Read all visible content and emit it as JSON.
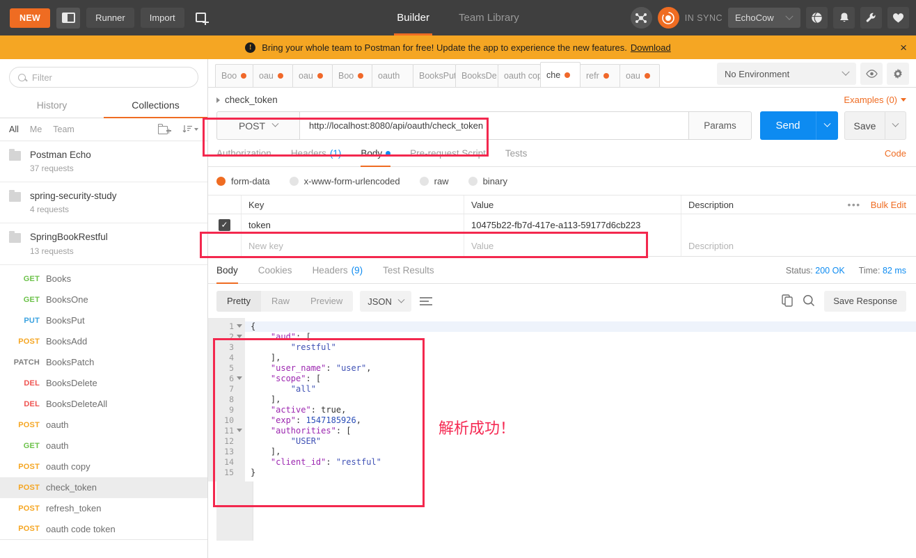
{
  "topbar": {
    "new_label": "NEW",
    "runner_label": "Runner",
    "import_label": "Import",
    "tabs": [
      {
        "label": "Builder",
        "active": true
      },
      {
        "label": "Team Library",
        "active": false
      }
    ],
    "sync_status": "IN SYNC",
    "user": "EchoCow",
    "icons": [
      "interceptor-icon",
      "sync-icon",
      "globe-icon",
      "bell-icon",
      "wrench-icon",
      "heart-icon"
    ]
  },
  "banner": {
    "text": "Bring your whole team to Postman for free! Update the app to experience the new features.",
    "link": "Download",
    "close": "×"
  },
  "sidebar": {
    "filter_placeholder": "Filter",
    "tabs": [
      {
        "label": "History",
        "active": false
      },
      {
        "label": "Collections",
        "active": true
      }
    ],
    "scopes": [
      {
        "label": "All",
        "active": true
      },
      {
        "label": "Me",
        "active": false
      },
      {
        "label": "Team",
        "active": false
      }
    ],
    "collections": [
      {
        "name": "Postman Echo",
        "requests": "37 requests"
      },
      {
        "name": "spring-security-study",
        "requests": "4 requests"
      },
      {
        "name": "SpringBookRestful",
        "requests": "13 requests"
      }
    ],
    "requests": [
      {
        "method": "GET",
        "name": "Books",
        "selected": false
      },
      {
        "method": "GET",
        "name": "BooksOne",
        "selected": false
      },
      {
        "method": "PUT",
        "name": "BooksPut",
        "selected": false
      },
      {
        "method": "POST",
        "name": "BooksAdd",
        "selected": false
      },
      {
        "method": "PATCH",
        "name": "BooksPatch",
        "selected": false
      },
      {
        "method": "DEL",
        "name": "BooksDelete",
        "selected": false
      },
      {
        "method": "DEL",
        "name": "BooksDeleteAll",
        "selected": false
      },
      {
        "method": "POST",
        "name": "oauth",
        "selected": false
      },
      {
        "method": "GET",
        "name": "oauth",
        "selected": false
      },
      {
        "method": "POST",
        "name": "oauth copy",
        "selected": false
      },
      {
        "method": "POST",
        "name": "check_token",
        "selected": true
      },
      {
        "method": "POST",
        "name": "refresh_token",
        "selected": false
      },
      {
        "method": "POST",
        "name": "oauth code token",
        "selected": false
      }
    ]
  },
  "request_tabs": [
    {
      "label": "Boo",
      "dot": true,
      "active": false
    },
    {
      "label": "oau",
      "dot": true,
      "active": false
    },
    {
      "label": "oau",
      "dot": true,
      "active": false
    },
    {
      "label": "Boo",
      "dot": true,
      "active": false
    },
    {
      "label": "oauth",
      "dot": false,
      "active": false
    },
    {
      "label": "BooksPut",
      "dot": false,
      "active": false
    },
    {
      "label": "BooksDe",
      "dot": false,
      "active": false
    },
    {
      "label": "oauth cop",
      "dot": false,
      "active": false
    },
    {
      "label": "che",
      "dot": true,
      "active": true
    },
    {
      "label": "refr",
      "dot": true,
      "active": false
    },
    {
      "label": "oau",
      "dot": true,
      "active": false
    }
  ],
  "environment": {
    "selected": "No Environment",
    "eye_icon": "eye-icon",
    "gear_icon": "gear-icon"
  },
  "breadcrumb": {
    "name": "check_token",
    "examples": "Examples (0)"
  },
  "url_bar": {
    "method": "POST",
    "url": "http://localhost:8080/api/oauth/check_token",
    "params_label": "Params",
    "send_label": "Send",
    "save_label": "Save"
  },
  "request_panel": {
    "tabs": [
      {
        "label": "Authorization",
        "active": false,
        "count": "",
        "dot": false
      },
      {
        "label": "Headers",
        "active": false,
        "count": "(1)",
        "dot": false
      },
      {
        "label": "Body",
        "active": true,
        "count": "",
        "dot": true
      },
      {
        "label": "Pre-request Script",
        "active": false,
        "count": "",
        "dot": false
      },
      {
        "label": "Tests",
        "active": false,
        "count": "",
        "dot": false
      }
    ],
    "code_link": "Code",
    "body_types": [
      {
        "label": "form-data",
        "selected": true
      },
      {
        "label": "x-www-form-urlencoded",
        "selected": false
      },
      {
        "label": "raw",
        "selected": false
      },
      {
        "label": "binary",
        "selected": false
      }
    ],
    "table_headers": {
      "key": "Key",
      "value": "Value",
      "description": "Description"
    },
    "bulk_edit": "Bulk Edit",
    "rows": [
      {
        "checked": true,
        "key": "token",
        "value": "10475b22-fb7d-417e-a113-59177d6cb223",
        "description": ""
      }
    ],
    "new_row": {
      "key": "New key",
      "value": "Value",
      "description": "Description"
    }
  },
  "response_panel": {
    "tabs": [
      {
        "label": "Body",
        "active": true,
        "count": ""
      },
      {
        "label": "Cookies",
        "active": false,
        "count": ""
      },
      {
        "label": "Headers",
        "active": false,
        "count": "(9)"
      },
      {
        "label": "Test Results",
        "active": false,
        "count": ""
      }
    ],
    "status_label": "Status:",
    "status_value": "200 OK",
    "time_label": "Time:",
    "time_value": "82 ms",
    "format_modes": [
      {
        "label": "Pretty",
        "active": true
      },
      {
        "label": "Raw",
        "active": false
      },
      {
        "label": "Preview",
        "active": false
      }
    ],
    "language": "JSON",
    "save_response": "Save Response",
    "copy_icon": "copy-icon",
    "search_icon": "search-icon",
    "wrap_icon": "wrap-lines-icon",
    "body_lines": [
      {
        "n": "1",
        "fold": true,
        "text": "{"
      },
      {
        "n": "2",
        "fold": true,
        "text": "    \"aud\": ["
      },
      {
        "n": "3",
        "fold": false,
        "text": "        \"restful\""
      },
      {
        "n": "4",
        "fold": false,
        "text": "    ],"
      },
      {
        "n": "5",
        "fold": false,
        "text": "    \"user_name\": \"user\","
      },
      {
        "n": "6",
        "fold": true,
        "text": "    \"scope\": ["
      },
      {
        "n": "7",
        "fold": false,
        "text": "        \"all\""
      },
      {
        "n": "8",
        "fold": false,
        "text": "    ],"
      },
      {
        "n": "9",
        "fold": false,
        "text": "    \"active\": true,"
      },
      {
        "n": "10",
        "fold": false,
        "text": "    \"exp\": 1547185926,"
      },
      {
        "n": "11",
        "fold": true,
        "text": "    \"authorities\": ["
      },
      {
        "n": "12",
        "fold": false,
        "text": "        \"USER\""
      },
      {
        "n": "13",
        "fold": false,
        "text": "    ],"
      },
      {
        "n": "14",
        "fold": false,
        "text": "    \"client_id\": \"restful\""
      },
      {
        "n": "15",
        "fold": false,
        "text": "}"
      }
    ],
    "body_json": {
      "aud": [
        "restful"
      ],
      "user_name": "user",
      "scope": [
        "all"
      ],
      "active": true,
      "exp": 1547185926,
      "authorities": [
        "USER"
      ],
      "client_id": "restful"
    }
  },
  "annotations": {
    "success_text": "解析成功！",
    "highlight_color": "#f3284e"
  }
}
